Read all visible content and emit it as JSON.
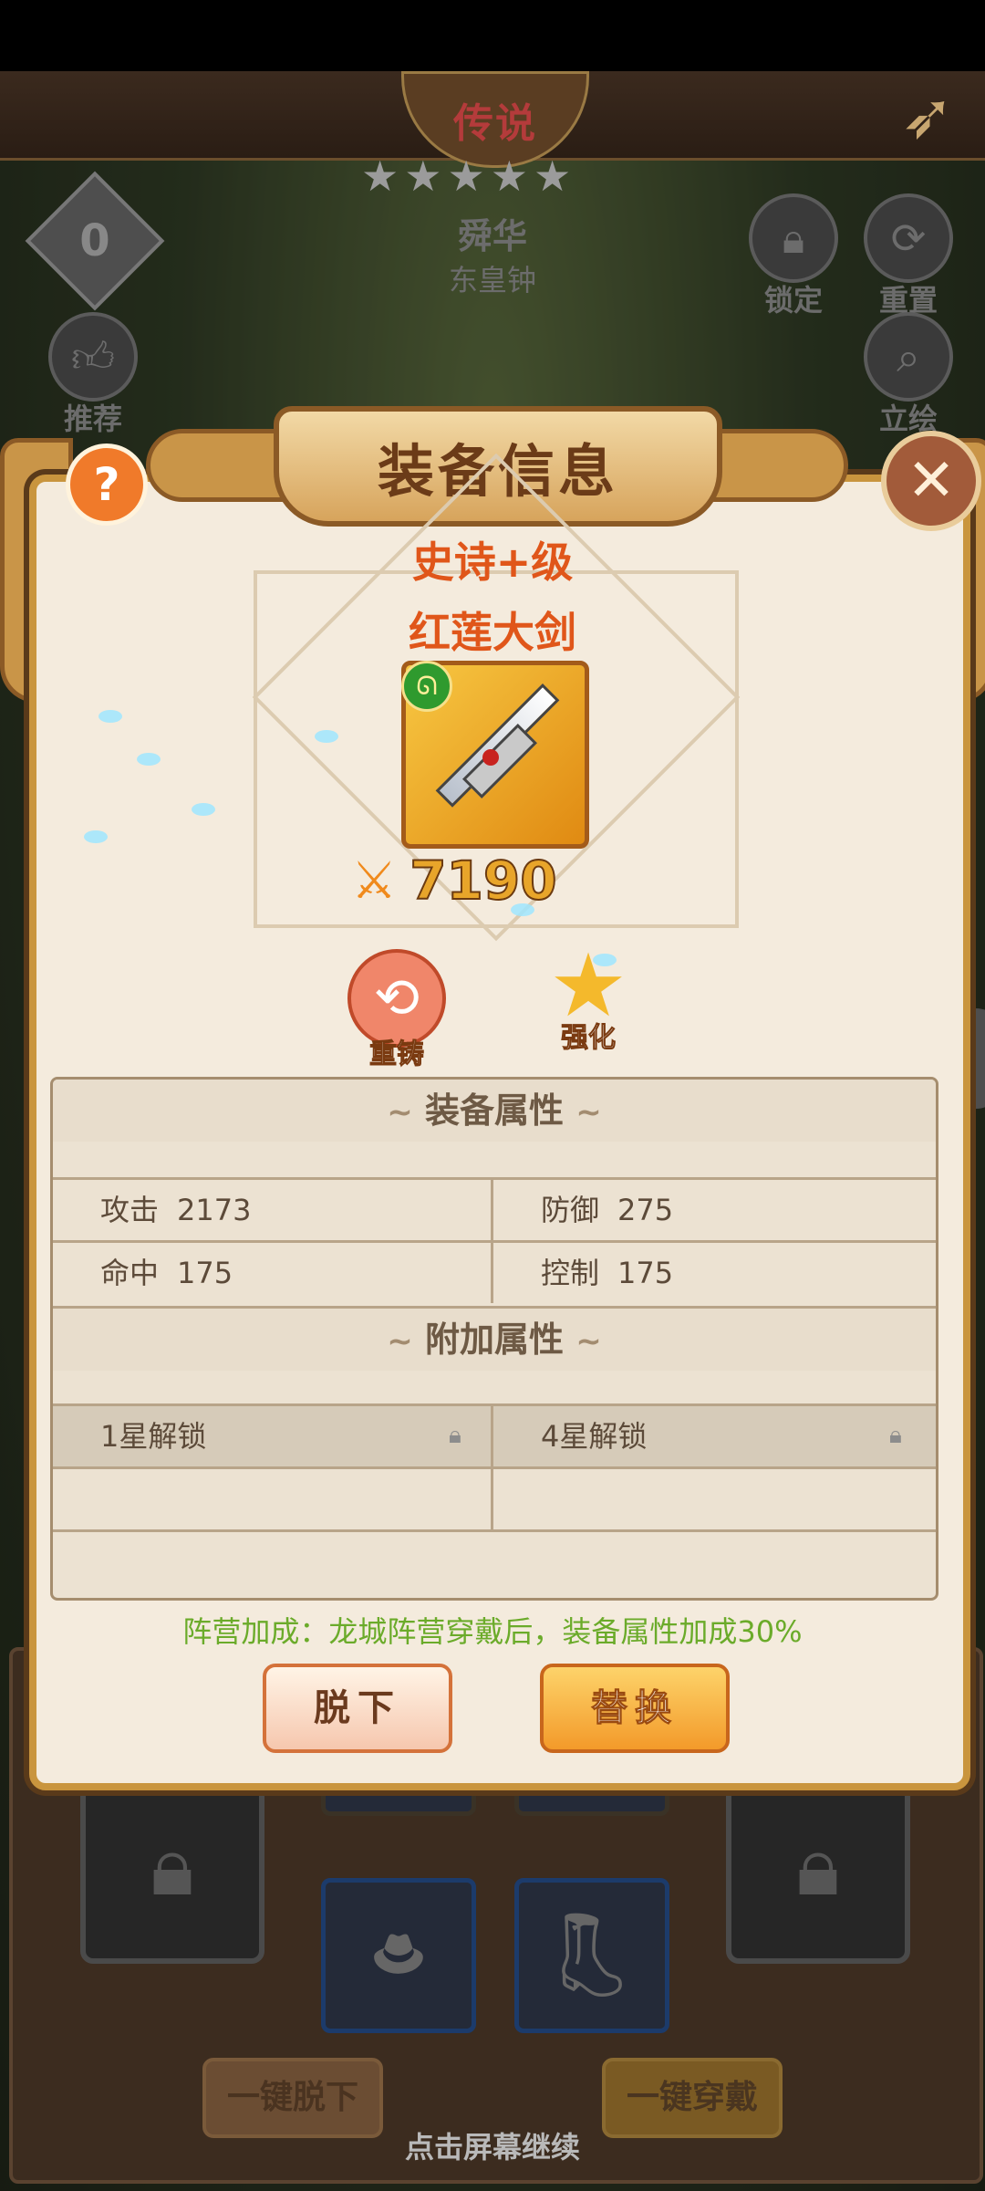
{
  "hero_screen": {
    "rank_label": "传说",
    "stars": [
      "★",
      "★",
      "★",
      "★",
      "★"
    ],
    "hero_name": "舜华",
    "hero_subtitle": "东皇钟",
    "faction_badge_text": "0",
    "buttons": {
      "recommend": "推荐",
      "lock": "锁定",
      "reset": "重置",
      "portrait": "立绘"
    },
    "icons": {
      "back": "back-arrow-icon",
      "recommend": "thumbs-up-icon",
      "lock": "lock-icon",
      "reset": "refresh-icon",
      "portrait": "magnifier-icon"
    },
    "bottom": {
      "unequip_all": "一键脱下",
      "equip_all": "一键穿戴",
      "continue_hint": "点击屏幕继续"
    }
  },
  "modal": {
    "title": "装备信息",
    "help_label": "?",
    "close_label": "✕",
    "item": {
      "grade": "史诗+级",
      "name": "红莲大剑",
      "power": "7190",
      "faction_symbol": "ᘏ"
    },
    "actions": {
      "reforge": "重铸",
      "enhance": "强化"
    },
    "sections": {
      "base_title": "装备属性",
      "extra_title": "附加属性",
      "ornament": "~"
    },
    "base_stats": [
      {
        "key": "攻击",
        "value": "2173"
      },
      {
        "key": "防御",
        "value": "275"
      },
      {
        "key": "命中",
        "value": "175"
      },
      {
        "key": "控制",
        "value": "175"
      }
    ],
    "extra_stats": [
      {
        "label": "1星解锁",
        "locked": true
      },
      {
        "label": "4星解锁",
        "locked": true
      }
    ],
    "faction_bonus": "阵营加成：龙城阵营穿戴后，装备属性加成30%",
    "buttons": {
      "remove": "脱下",
      "replace": "替换"
    }
  },
  "colors": {
    "grade": "#e0561a",
    "bonus_text": "#6bab2a",
    "panel_bg": "#f4ebdd",
    "header_text": "#6b3b18"
  }
}
